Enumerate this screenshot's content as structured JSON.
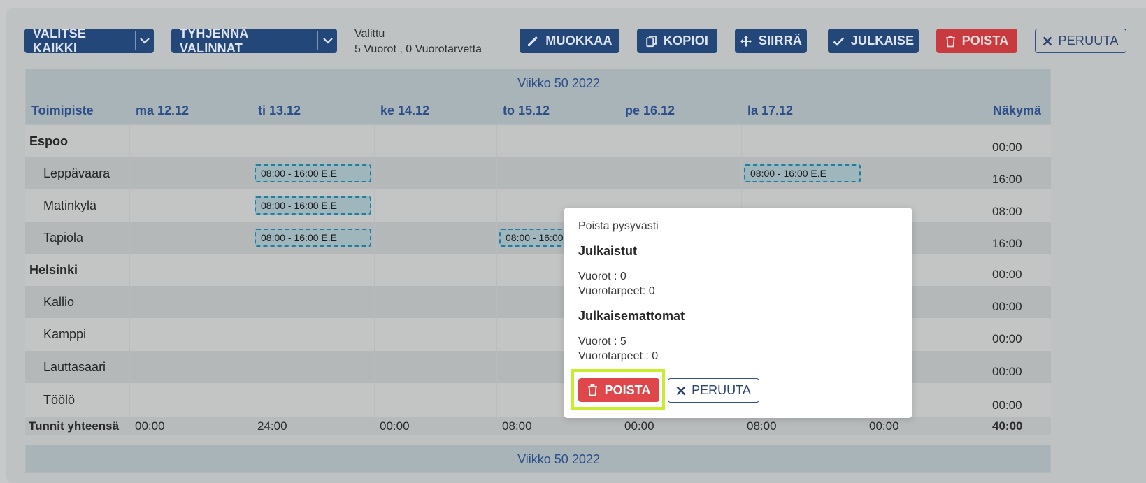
{
  "toolbar": {
    "select_all": "VALITSE KAIKKI",
    "clear_selection": "TYHJENNÄ VALINNAT",
    "selected_label": "Valittu",
    "selected_summary": "5 Vuorot , 0 Vuorotarvetta",
    "edit": "MUOKKAA",
    "copy": "KOPIOI",
    "move": "SIIRRÄ",
    "publish": "JULKAISE",
    "delete": "POISTA",
    "cancel": "PERUUTA"
  },
  "schedule": {
    "week_title": "Viikko 50 2022",
    "location_header": "Toimipiste",
    "view_header": "Näkymä",
    "days": [
      "ma 12.12",
      "ti 13.12",
      "ke 14.12",
      "to 15.12",
      "pe 16.12",
      "la 17.12",
      ""
    ],
    "rows": [
      {
        "name": "Espoo",
        "group": true,
        "total": "00:00"
      },
      {
        "name": "Leppävaara",
        "group": false,
        "total": "16:00"
      },
      {
        "name": "Matinkylä",
        "group": false,
        "total": "08:00"
      },
      {
        "name": "Tapiola",
        "group": false,
        "total": "16:00"
      },
      {
        "name": "Helsinki",
        "group": true,
        "total": "00:00"
      },
      {
        "name": "Kallio",
        "group": false,
        "total": "00:00"
      },
      {
        "name": "Kamppi",
        "group": false,
        "total": "00:00"
      },
      {
        "name": "Lauttasaari",
        "group": false,
        "total": "00:00"
      },
      {
        "name": "Töölö",
        "group": false,
        "total": "00:00"
      }
    ],
    "shifts": {
      "leppavaara_tue": "08:00 - 16:00 E.E",
      "leppavaara_sat": "08:00 - 16:00 E.E",
      "matinkyla_tue": "08:00 - 16:00 E.E",
      "tapiola_tue": "08:00 - 16:00 E.E",
      "tapiola_thu": "08:00 - 16:00 E.E"
    },
    "totals_label": "Tunnit yhteensä",
    "day_totals": [
      "00:00",
      "24:00",
      "00:00",
      "08:00",
      "00:00",
      "08:00",
      "00:00"
    ],
    "grand_total": "40:00",
    "week_title_2": "Viikko 50 2022"
  },
  "modal": {
    "title": "Poista pysyvästi",
    "published_heading": "Julkaistut",
    "published_shifts": "Vuorot : 0",
    "published_needs": "Vuorotarpeet: 0",
    "unpublished_heading": "Julkaisemattomat",
    "unpublished_shifts": "Vuorot : 5",
    "unpublished_needs": "Vuorotarpeet : 0",
    "delete_button": "POISTA",
    "cancel_button": "PERUUTA"
  },
  "colors": {
    "primary": "#24477a",
    "danger": "#e0474a",
    "highlight": "#c6ee2d",
    "shift_border": "#1f7fa3"
  }
}
